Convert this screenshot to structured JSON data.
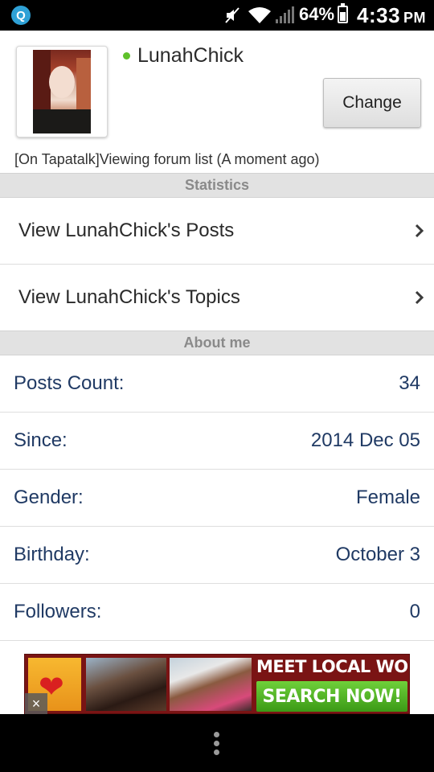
{
  "status_bar": {
    "app_icon_glyph": "Q",
    "battery_percent": "64%",
    "time": "4:33",
    "ampm": "PM"
  },
  "profile": {
    "username": "LunahChick",
    "change_label": "Change",
    "activity": "[On Tapatalk]Viewing forum list (A moment ago)",
    "online_color": "#5fc12a"
  },
  "sections": {
    "statistics": "Statistics",
    "about": "About me"
  },
  "links": [
    {
      "label": "View LunahChick's Posts"
    },
    {
      "label": "View LunahChick's Topics"
    }
  ],
  "about": [
    {
      "key": "Posts Count:",
      "value": "34"
    },
    {
      "key": "Since:",
      "value": "2014 Dec 05"
    },
    {
      "key": "Gender:",
      "value": "Female"
    },
    {
      "key": "Birthday:",
      "value": "October 3"
    },
    {
      "key": "Followers:",
      "value": "0"
    }
  ],
  "ad": {
    "headline": "MEET LOCAL WOMEN",
    "cta": "SEARCH NOW!",
    "close_glyph": "×"
  },
  "icons": {
    "chevron": "chevron-right-icon",
    "menu": "overflow-menu-icon"
  }
}
